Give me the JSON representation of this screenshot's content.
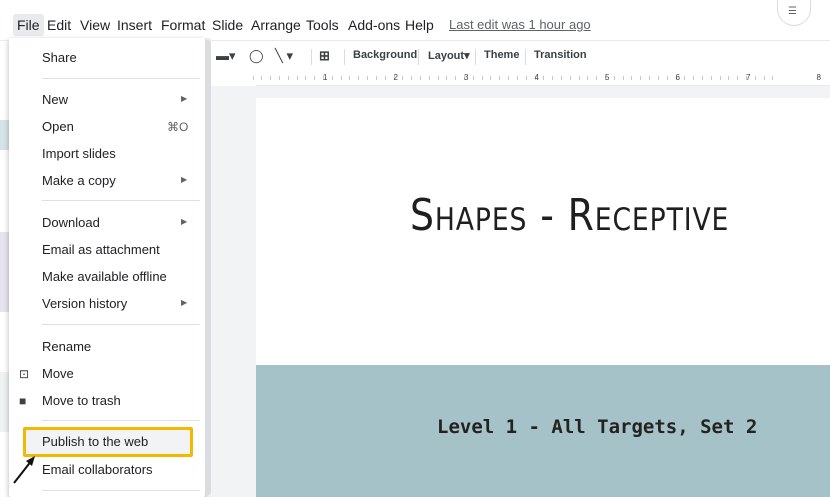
{
  "menubar": {
    "items": [
      "File",
      "Edit",
      "View",
      "Insert",
      "Format",
      "Slide",
      "Arrange",
      "Tools",
      "Add-ons",
      "Help"
    ],
    "last_edit": "Last edit was 1 hour ago"
  },
  "toolbar": {
    "background": "Background",
    "layout": "Layout",
    "theme": "Theme",
    "transition": "Transition"
  },
  "ruler": {
    "numbers": [
      "1",
      "2",
      "3",
      "4",
      "5",
      "6",
      "7",
      "8"
    ]
  },
  "slide": {
    "title": "Shapes - Receptive",
    "subtitle": "Level 1 - All Targets, Set 2",
    "band_color": "#a4c2c7"
  },
  "file_menu": {
    "share": "Share",
    "new": "New",
    "open": "Open",
    "open_shortcut": "⌘O",
    "import_slides": "Import slides",
    "make_a_copy": "Make a copy",
    "download": "Download",
    "email_as_attachment": "Email as attachment",
    "make_available_offline": "Make available offline",
    "version_history": "Version history",
    "rename": "Rename",
    "move": "Move",
    "move_to_trash": "Move to trash",
    "publish_to_the_web": "Publish to the web",
    "email_collaborators": "Email collaborators",
    "highlight_color": "#f5b800"
  }
}
